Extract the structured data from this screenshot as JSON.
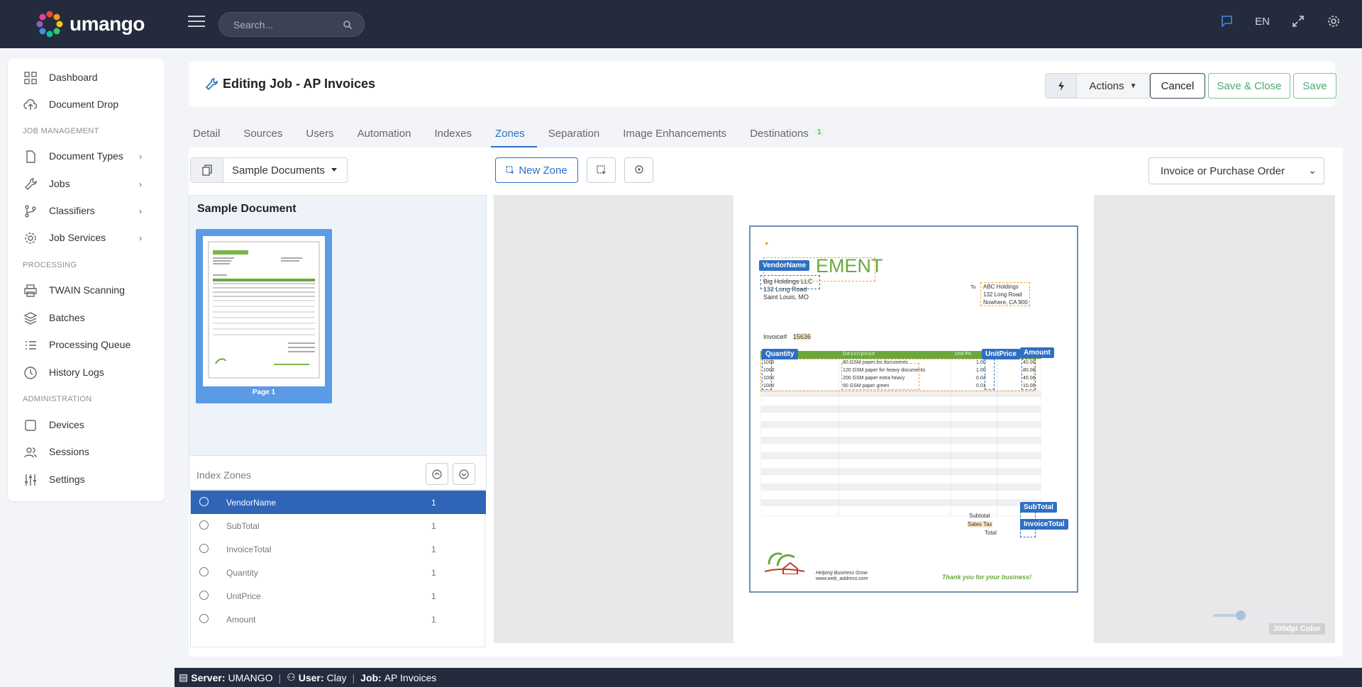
{
  "app": {
    "brand": "umango",
    "search_placeholder": "Search...",
    "language": "EN"
  },
  "sidebar": {
    "items_top": [
      {
        "label": "Dashboard",
        "icon": "dashboard-icon"
      },
      {
        "label": "Document Drop",
        "icon": "cloud-upload-icon"
      }
    ],
    "section_job": "JOB MANAGEMENT",
    "items_job": [
      {
        "label": "Document Types",
        "icon": "document-icon"
      },
      {
        "label": "Jobs",
        "icon": "wrench-icon"
      },
      {
        "label": "Classifiers",
        "icon": "branch-icon"
      },
      {
        "label": "Job Services",
        "icon": "gear-icon"
      }
    ],
    "section_processing": "PROCESSING",
    "items_processing": [
      {
        "label": "TWAIN Scanning",
        "icon": "printer-icon"
      },
      {
        "label": "Batches",
        "icon": "layers-icon"
      },
      {
        "label": "Processing Queue",
        "icon": "list-icon"
      },
      {
        "label": "History Logs",
        "icon": "clock-icon"
      }
    ],
    "section_admin": "ADMINISTRATION",
    "items_admin": [
      {
        "label": "Devices",
        "icon": "square-icon"
      },
      {
        "label": "Sessions",
        "icon": "users-icon"
      },
      {
        "label": "Settings",
        "icon": "sliders-icon"
      }
    ]
  },
  "header": {
    "title": "Editing Job - AP Invoices",
    "actions_label": "Actions",
    "cancel_label": "Cancel",
    "save_close_label": "Save & Close",
    "save_label": "Save"
  },
  "tabs": [
    {
      "label": "Detail"
    },
    {
      "label": "Sources"
    },
    {
      "label": "Users"
    },
    {
      "label": "Automation"
    },
    {
      "label": "Indexes"
    },
    {
      "label": "Zones"
    },
    {
      "label": "Separation"
    },
    {
      "label": "Image Enhancements"
    },
    {
      "label": "Destinations",
      "badge": "1"
    }
  ],
  "zones_view": {
    "sample_dropdown": "Sample Documents",
    "sample_title": "Sample Document",
    "page_label": "Page 1",
    "new_zone_label": "New Zone",
    "doc_type_select": "Invoice or Purchase Order",
    "index_zones_title": "Index Zones",
    "index_zones": [
      {
        "name": "VendorName",
        "count": "1",
        "selected": true
      },
      {
        "name": "SubTotal",
        "count": "1"
      },
      {
        "name": "InvoiceTotal",
        "count": "1"
      },
      {
        "name": "Quantity",
        "count": "1"
      },
      {
        "name": "UnitPrice",
        "count": "1"
      },
      {
        "name": "Amount",
        "count": "1"
      }
    ],
    "dpi_label": "300dpi Color",
    "zoom_level_fraction": 0.22
  },
  "document": {
    "heading_part": "EMENT",
    "vendor_lines": [
      "Big Holdings LLC",
      "132 Long Road",
      "Saint Louis, MO"
    ],
    "to_label": "To",
    "to_lines": [
      "ABC Holdings",
      "132 Long Road",
      "Nowhere, CA 900"
    ],
    "invoice_label": "Invoice#",
    "invoice_number": "15636",
    "columns": [
      "Quantity",
      "Description",
      "Unit Pri",
      "Amount"
    ],
    "rows": [
      {
        "qty": "1000",
        "desc": "80 GSM paper for documents",
        "price": "1.00",
        "amount": "40.00"
      },
      {
        "qty": "1000",
        "desc": "120 GSM paper for heavy documents",
        "price": "1.00",
        "amount": "80.00"
      },
      {
        "qty": "1000",
        "desc": "200 GSM paper extra heavy",
        "price": "0.04",
        "amount": "40.00"
      },
      {
        "qty": "1000",
        "desc": "50 GSM paper green",
        "price": "0.01",
        "amount": "10.00"
      }
    ],
    "subtotal_label": "Subtotal",
    "salestax_label": "Sales Tax",
    "total_label": "Total",
    "footer_tagline": "Helping Business Grow",
    "footer_url": "www.web_address.com",
    "thanks": "Thank you for your business!",
    "zone_tags": [
      "VendorName",
      "Quantity",
      "UnitPrice",
      "Amount",
      "SubTotal",
      "InvoiceTotal"
    ]
  },
  "footer": {
    "server_label": "Server:",
    "server_value": "UMANGO",
    "user_label": "User:",
    "user_value": "Clay",
    "job_label": "Job:",
    "job_value": "AP Invoices"
  },
  "colors": {
    "topbar": "#242b3d",
    "accent": "#2a6fc9",
    "save_green": "#4aa873",
    "zone_blue": "#2f6fc2",
    "zone_orange": "#f0a530"
  }
}
